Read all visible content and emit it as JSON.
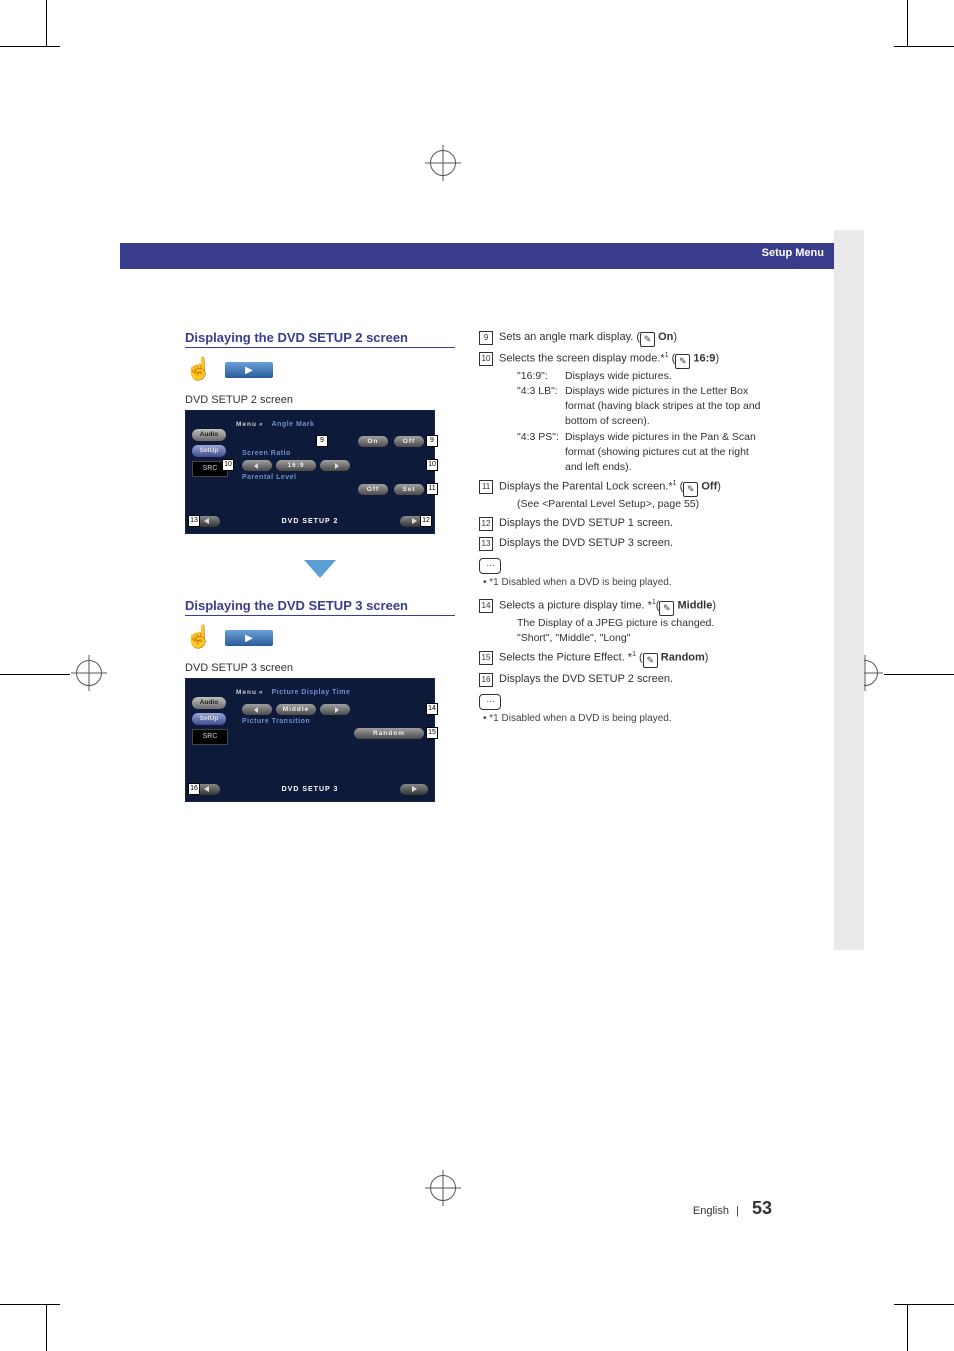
{
  "header": {
    "title": "Setup Menu"
  },
  "section2": {
    "title": "Displaying the DVD SETUP 2 screen",
    "screen_label": "DVD SETUP 2 screen",
    "device": {
      "side": {
        "audio": "Audio",
        "setup": "SetUp",
        "src": "SRC"
      },
      "menu": "Menu",
      "angle_mark": {
        "label": "Angle Mark",
        "on": "On",
        "off": "Off"
      },
      "screen_ratio": {
        "label": "Screen Ratio",
        "value": "16:9"
      },
      "parental": {
        "label": "Parental Level",
        "value": "Off",
        "set": "Set"
      },
      "footer_title": "DVD SETUP 2"
    },
    "callouts": {
      "c9": "9",
      "c10": "10",
      "c11": "11",
      "c12": "12",
      "c13": "13"
    }
  },
  "section3": {
    "title": "Displaying the DVD SETUP 3 screen",
    "screen_label": "DVD SETUP 3 screen",
    "device": {
      "side": {
        "audio": "Audio",
        "setup": "SetUp",
        "src": "SRC"
      },
      "menu": "Menu",
      "pic_time": {
        "label": "Picture Display Time",
        "value": "Middle"
      },
      "pic_trans": {
        "label": "Picture Transition",
        "value": "Random"
      },
      "footer_title": "DVD SETUP 3"
    },
    "callouts": {
      "c14": "14",
      "c15": "15",
      "c16": "16"
    }
  },
  "right2": {
    "items": [
      {
        "n": "9",
        "text": "Sets an angle mark display. (",
        "def": "On",
        "tail": ")"
      },
      {
        "n": "10",
        "text": "Selects the screen display mode.*",
        "sup": "1",
        "mid": " (",
        "def": "16:9",
        "tail": ")",
        "subs": [
          {
            "k": "\"16:9\":",
            "v": "Displays wide pictures."
          },
          {
            "k": "\"4:3 LB\":",
            "v": "Displays wide pictures in the Letter Box format (having black stripes at the top and bottom of screen)."
          },
          {
            "k": "\"4:3 PS\":",
            "v": "Displays wide pictures in the Pan & Scan format (showing pictures cut at the right and left ends)."
          }
        ]
      },
      {
        "n": "11",
        "text": "Displays the Parental Lock screen.*",
        "sup": "1",
        "mid": " (",
        "def": "Off",
        "tail": ")",
        "extra": "(See <Parental Level Setup>, page 55)"
      },
      {
        "n": "12",
        "text": "Displays the DVD SETUP 1 screen."
      },
      {
        "n": "13",
        "text": "Displays the DVD SETUP 3 screen."
      }
    ],
    "note": "• *1 Disabled when a DVD is being played."
  },
  "right3": {
    "items": [
      {
        "n": "14",
        "text": "Selects a picture display time. *",
        "sup": "1",
        "mid": "(",
        "def": "Middle",
        "tail": ")",
        "extra": "The Display of a JPEG picture is changed.",
        "extra2": "\"Short\", \"Middle\", \"Long\""
      },
      {
        "n": "15",
        "text": "Selects the Picture Effect. *",
        "sup": "1",
        "mid": " (",
        "def": "Random",
        "tail": ")"
      },
      {
        "n": "16",
        "text": "Displays the DVD SETUP 2 screen."
      }
    ],
    "note": "• *1 Disabled when a DVD is being played."
  },
  "footer": {
    "lang": "English",
    "sep": "|",
    "page": "53"
  }
}
